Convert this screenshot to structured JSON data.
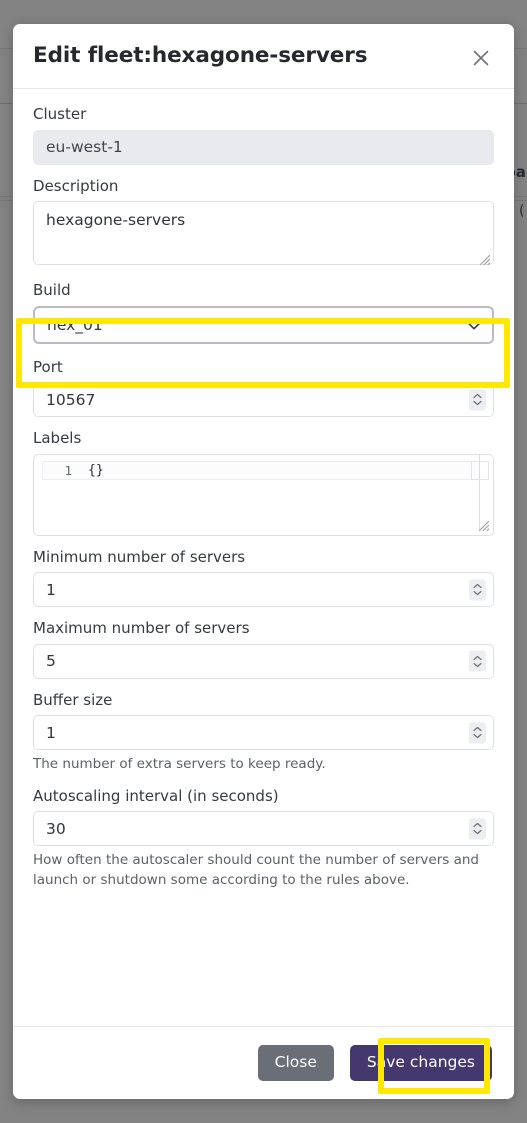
{
  "background": {
    "partial_text_bold": "pa",
    "partial_text_plain": "("
  },
  "modal": {
    "title": "Edit fleet:hexagone-servers",
    "close_icon": "close-icon",
    "fields": {
      "cluster": {
        "label": "Cluster",
        "value": "eu-west-1"
      },
      "description": {
        "label": "Description",
        "value": "hexagone-servers"
      },
      "build": {
        "label": "Build",
        "value": "hex_01",
        "options": [
          "hex_01"
        ],
        "chevron_icon": "chevron-down-icon"
      },
      "port": {
        "label": "Port",
        "value": "10567"
      },
      "labels": {
        "label": "Labels",
        "line_number": "1",
        "value": "{}"
      },
      "min_servers": {
        "label": "Minimum number of servers",
        "value": "1"
      },
      "max_servers": {
        "label": "Maximum number of servers",
        "value": "5"
      },
      "buffer_size": {
        "label": "Buffer size",
        "value": "1",
        "help": "The number of extra servers to keep ready."
      },
      "autoscaling_interval": {
        "label": "Autoscaling interval (in seconds)",
        "value": "30",
        "help": "How often the autoscaler should count the number of servers and launch or shutdown some according to the rules above."
      }
    },
    "footer": {
      "close_label": "Close",
      "save_label": "Save changes"
    }
  },
  "colors": {
    "primary_button": "#44386e",
    "secondary_button": "#6a6e77",
    "highlight": "#ffe800",
    "disabled_field": "#e8eaed"
  }
}
